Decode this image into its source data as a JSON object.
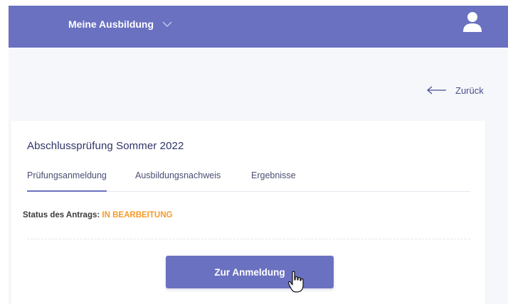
{
  "topbar": {
    "menu_label": "Meine Ausbildung",
    "menu_icon": "chevron-down-icon",
    "user_icon": "user-icon",
    "color": "#6a71c0"
  },
  "back": {
    "label": "Zurück",
    "icon": "arrow-left-icon"
  },
  "card": {
    "title": "Abschlussprüfung Sommer 2022",
    "tabs": [
      {
        "label": "Prüfungsanmeldung",
        "active": true
      },
      {
        "label": "Ausbildungsnachweis",
        "active": false
      },
      {
        "label": "Ergebnisse",
        "active": false
      }
    ],
    "status_label": "Status des Antrags:",
    "status_value": "IN BEARBEITUNG",
    "status_color": "#f59a2a",
    "button_label": "Zur Anmeldung"
  }
}
